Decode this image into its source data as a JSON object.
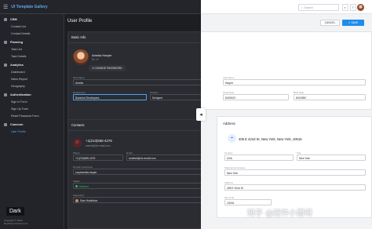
{
  "app": {
    "title": "UI Template Gallery"
  },
  "sidebar": {
    "groups": [
      {
        "label": "CRM",
        "items": [
          "Contact List",
          "Contact Details"
        ]
      },
      {
        "label": "Planning",
        "items": [
          "Task List",
          "Task Details"
        ]
      },
      {
        "label": "Analytics",
        "items": [
          "Dashboard",
          "Sales Report",
          "Geography"
        ]
      },
      {
        "label": "Authentication",
        "items": [
          "Sign In Form",
          "Sign Up Form",
          "Reset Password Form"
        ]
      },
      {
        "label": "Common",
        "items": [
          "User Profile"
        ]
      }
    ],
    "active_item": "User Profile"
  },
  "theme_badge": "Dark",
  "copyright": [
    "Copyright © 2022-",
    "Developer Express Inc."
  ],
  "header": {
    "search_placeholder": "Search"
  },
  "actions": {
    "cancel": "CANCEL",
    "save": "SAVE"
  },
  "page": {
    "title": "User Profile"
  },
  "basic_info": {
    "title": "Basic Info",
    "name": "Amelia Harper",
    "sub": "ID: 17",
    "change_password": "CHANGE PASSWORD",
    "fields": {
      "first_name": {
        "label": "First Name",
        "value": "Amelia"
      },
      "last_name": {
        "label": "Last Name",
        "value": "Harper"
      },
      "department": {
        "label": "Department",
        "value": "Backend Developers"
      },
      "position": {
        "label": "Position",
        "value": "Designer"
      },
      "hired_date": {
        "label": "Hired Date",
        "value": "8/3/2023"
      },
      "birth_date": {
        "label": "Birth Date",
        "value": "8/3/1980"
      }
    }
  },
  "contacts": {
    "title": "Contacts",
    "phone_display": "+1(213)555-4276",
    "email_display": "amelia@dx-email.com",
    "fields": {
      "phone": {
        "label": "Phone",
        "value": "+1(213)555-4276"
      },
      "email": {
        "label": "Email",
        "value": "ameliah@dx-email.com"
      },
      "domain": {
        "label": "Domain Username",
        "value": "corp\\amelia.harper"
      },
      "status": {
        "label": "Status",
        "value": "Salaried"
      },
      "supervisor": {
        "label": "Supervisor",
        "value": "Sam Hutchison"
      }
    }
  },
  "address": {
    "title": "Address",
    "display": "405 E 42nd St, New York, New York, 10016",
    "fields": {
      "country": {
        "label": "Country",
        "value": "USA"
      },
      "city": {
        "label": "City",
        "value": "New York"
      },
      "state": {
        "label": "State/province/area",
        "value": "New York"
      },
      "address": {
        "label": "Address",
        "value": "405 E 42nd St"
      },
      "zip": {
        "label": "Zip Code",
        "value": "10016"
      }
    }
  },
  "colors": {
    "accent": "#1f8ceb",
    "dark_bg": "#2b2d33",
    "status_green": "#3bb24e"
  },
  "watermark": "知乎 @控件小惠呀"
}
